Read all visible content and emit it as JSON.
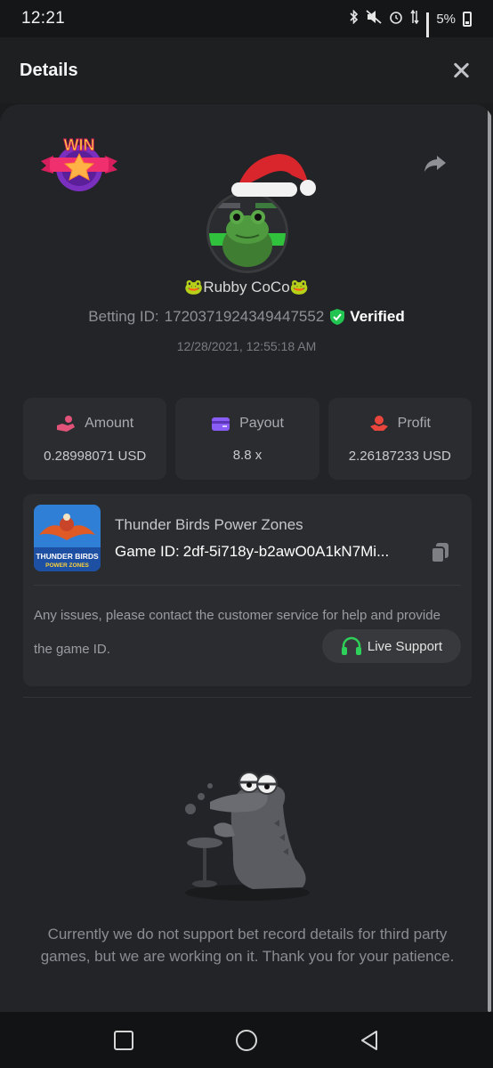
{
  "status_bar": {
    "time": "12:21",
    "battery": "5%"
  },
  "header": {
    "title": "Details"
  },
  "bet": {
    "username": "🐸Rubby CoCo🐸",
    "betting_id_label": "Betting ID:",
    "betting_id": "1720371924349447552",
    "verified_label": "Verified",
    "datetime": "12/28/2021, 12:55:18 AM",
    "badge_text": "WIN"
  },
  "stats": [
    {
      "label": "Amount",
      "value": "0.28998071 USD",
      "icon": "hand-coins-icon"
    },
    {
      "label": "Payout",
      "value": "8.8 x",
      "icon": "wallet-icon"
    },
    {
      "label": "Profit",
      "value": "2.26187233 USD",
      "icon": "profit-hand-icon"
    }
  ],
  "game": {
    "name": "Thunder Birds Power Zones",
    "id_label": "Game ID:",
    "id_value": "2df-5i718y-b2awO0A1kN7Mi...",
    "thumb_title": "THUNDER BIRDS",
    "thumb_subtitle": "POWER ZONES",
    "notice": "Any issues, please contact the customer service for help and provide the game ID.",
    "support_label": "Live Support"
  },
  "footer": {
    "message": "Currently we do not support bet record details for third party games, but we are working on it. Thank you for your patience."
  },
  "colors": {
    "accent_green": "#2fd05a",
    "verified_green": "#23c552",
    "profit_red": "#e8453c",
    "payout_purple": "#8a5cf6",
    "amount_pink": "#e2537a"
  }
}
